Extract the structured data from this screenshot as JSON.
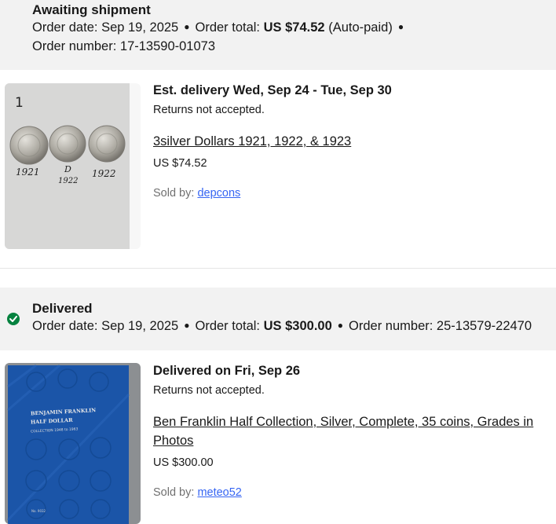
{
  "orders": [
    {
      "status": "Awaiting shipment",
      "order_date_label": "Order date:",
      "order_date": "Sep 19, 2025",
      "order_total_label": "Order total:",
      "order_total": "US $74.52",
      "payment_note": "(Auto-paid)",
      "order_number_label": "Order number:",
      "order_number": "17-13590-01073",
      "item": {
        "delivery_text": "Est. delivery Wed, Sep 24 - Tue, Sep 30",
        "returns_text": "Returns not accepted.",
        "title": "3silver Dollars 1921, 1922, & 1923",
        "price": "US $74.52",
        "sold_by_label": "Sold by:",
        "seller": "depcons",
        "photo_markings": [
          "1",
          "1921",
          "D",
          "1922",
          "1922"
        ]
      }
    },
    {
      "status": "Delivered",
      "status_icon": "check-circle-icon",
      "status_color": "#05823f",
      "order_date_label": "Order date:",
      "order_date": "Sep 19, 2025",
      "order_total_label": "Order total:",
      "order_total": "US $300.00",
      "order_number_label": "Order number:",
      "order_number": "25-13579-22470",
      "item": {
        "delivery_text": "Delivered on Fri, Sep 26",
        "returns_text": "Returns not accepted.",
        "title": "Ben Franklin Half Collection, Silver, Complete, 35 coins, Grades in Photos",
        "price": "US $300.00",
        "sold_by_label": "Sold by:",
        "seller": "meteo52",
        "photo_markings": [
          "BENJAMIN FRANKLIN",
          "HALF DOLLAR",
          "COLLECTION 1948 to 1963",
          "No. 9032"
        ]
      }
    }
  ],
  "colors": {
    "header_bg": "#f2f2f2",
    "link": "#3665f3",
    "muted_text": "#707070",
    "folder_blue": "#1b55a8"
  }
}
